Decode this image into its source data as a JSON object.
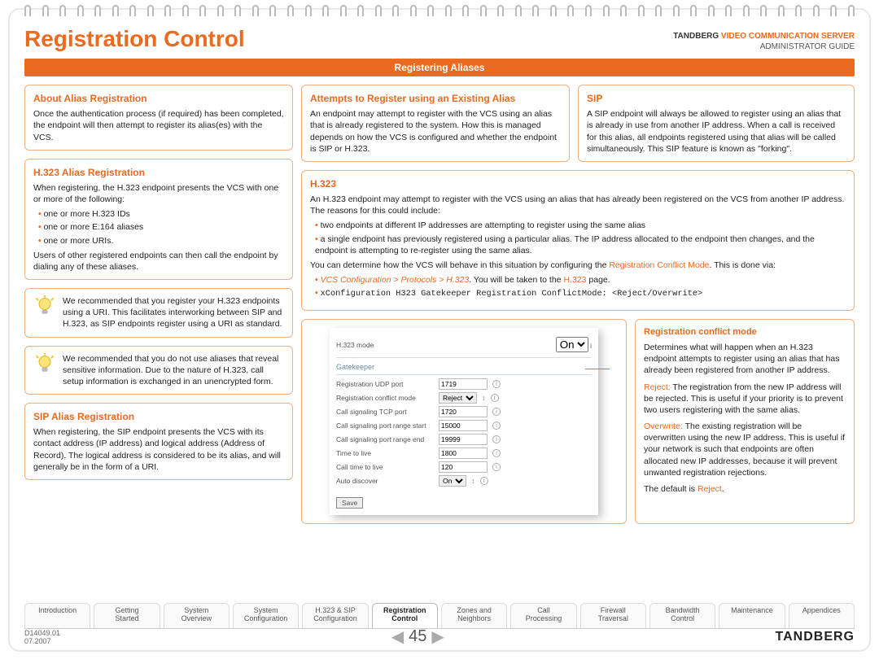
{
  "header": {
    "title": "Registration Control",
    "brand_tb": "TANDBERG",
    "brand_vcs": "VIDEO COMMUNICATION SERVER",
    "brand_sub": "ADMINISTRATOR GUIDE"
  },
  "banner": "Registering Aliases",
  "left": {
    "about": {
      "h": "About Alias Registration",
      "p": "Once the authentication process (if required) has been completed, the endpoint will then attempt to register its alias(es) with the VCS."
    },
    "h323": {
      "h": "H.323 Alias Registration",
      "p1": "When registering, the H.323 endpoint presents the VCS with one or more of the following:",
      "li1": "one or more H.323 IDs",
      "li2": "one or more E.164 aliases",
      "li3": "one or more URIs.",
      "p2": "Users of other registered endpoints can then call the endpoint by dialing any of these aliases."
    },
    "tip1": "We recommended that you register your H.323 endpoints using a URI. This facilitates interworking between SIP and H.323, as SIP endpoints register using a URI as standard.",
    "tip2": "We recommended that you do not use aliases that reveal sensitive information. Due to the nature of H.323, call setup information is exchanged in an unencrypted form.",
    "sip": {
      "h": "SIP Alias Registration",
      "p": "When registering, the SIP endpoint presents the VCS with its contact address (IP address) and logical address (Address of Record). The logical address is considered to be its alias, and will generally be in the form of a URI."
    }
  },
  "right_top": {
    "attempts": {
      "h": "Attempts to Register using an Existing Alias",
      "p": "An endpoint may attempt to register with the VCS using an alias that is already registered to the system. How this is managed depends on how the VCS is configured and whether the endpoint is SIP or H.323."
    },
    "sip": {
      "h": "SIP",
      "p": "A SIP endpoint will always be allowed to register using an alias that is already in use from another IP address. When a call is received for this alias, all endpoints registered using that alias will be called simultaneously. This SIP feature is known as \"forking\"."
    }
  },
  "h323box": {
    "h": "H.323",
    "p1": "An H.323 endpoint may attempt to register with the VCS using an alias that has already been registered on the VCS from another IP address. The reasons for this could include:",
    "li1": "two endpoints at different IP addresses are attempting to register using the same alias",
    "li2": "a single endpoint has previously registered using a particular alias. The IP address allocated to the endpoint then changes, and the endpoint is attempting to re-register using the same alias.",
    "p2a": "You can determine how the VCS will behave in this situation by configuring the ",
    "p2b": "Registration Conflict Mode",
    "p2c": ". This is done via:",
    "nav1": "VCS Configuration > Protocols > H.323",
    "nav2": ". You will be taken to the ",
    "nav3": "H.323",
    "nav4": " page.",
    "cmd": "xConfiguration H323 Gatekeeper Registration ConflictMode: <Reject/Overwrite>"
  },
  "screenshot": {
    "top_label": "H.323 mode",
    "top_val": "On",
    "section": "Gatekeeper",
    "rows": [
      {
        "l": "Registration UDP port",
        "v": "1719",
        "type": "text"
      },
      {
        "l": "Registration conflict mode",
        "v": "Reject",
        "type": "select"
      },
      {
        "l": "Call signaling TCP port",
        "v": "1720",
        "type": "text"
      },
      {
        "l": "Call signaling port range start",
        "v": "15000",
        "type": "text"
      },
      {
        "l": "Call signaling port range end",
        "v": "19999",
        "type": "text"
      },
      {
        "l": "Time to live",
        "v": "1800",
        "type": "text"
      },
      {
        "l": "Call time to live",
        "v": "120",
        "type": "text"
      },
      {
        "l": "Auto discover",
        "v": "On",
        "type": "select"
      }
    ],
    "btn": "Save"
  },
  "conflict": {
    "h": "Registration conflict mode",
    "p1": "Determines what will happen when an H.323 endpoint attempts to register using an alias that has already been registered from another IP address.",
    "rej_l": "Reject:",
    "rej": " The registration from the new IP address will be rejected. This is useful if your priority is to prevent two users registering with the same alias.",
    "ovr_l": "Overwrite:",
    "ovr": " The existing registration will be overwritten using the new IP address. This is useful if your network is such that endpoints are often allocated new IP addresses, because it will prevent unwanted registration rejections.",
    "def1": "The default is ",
    "def2": "Reject"
  },
  "tabs": [
    "Introduction",
    "Getting\nStarted",
    "System\nOverview",
    "System\nConfiguration",
    "H.323 & SIP\nConfiguration",
    "Registration\nControl",
    "Zones and\nNeighbors",
    "Call\nProcessing",
    "Firewall\nTraversal",
    "Bandwidth\nControl",
    "Maintenance",
    "Appendices"
  ],
  "footer": {
    "doc": "D14049.01",
    "date": "07.2007",
    "page": "45",
    "logo": "TANDBERG"
  }
}
